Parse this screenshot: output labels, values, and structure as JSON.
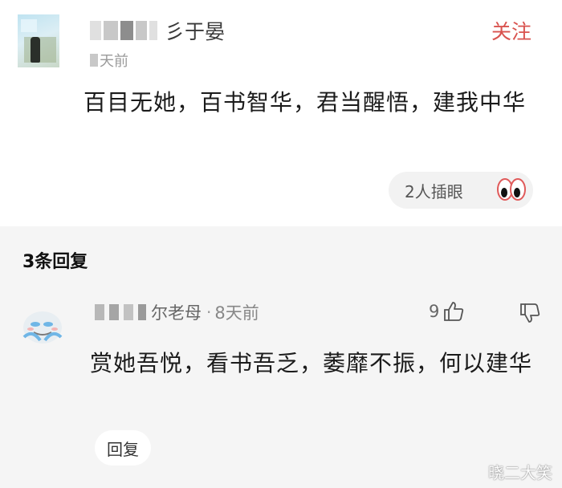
{
  "main_comment": {
    "username_suffix": "彡于晏",
    "time_suffix": "天前",
    "follow_label": "关注",
    "content": "百目无她，百书智华，君当醒悟，建我中华",
    "reaction_label": "2人插眼",
    "reaction_icon": "eyes-icon"
  },
  "replies": {
    "count_label": "3条回复",
    "items": [
      {
        "username_suffix": "尔老母",
        "separator": "·",
        "time": "8天前",
        "like_count": "9",
        "content": "赏她吾悦，看书吾乏，萎靡不振，何以建华",
        "reply_label": "回复"
      }
    ]
  },
  "watermark": "晓二大笑",
  "colors": {
    "follow": "#d9534f",
    "reply_bg": "#f5f5f5"
  }
}
